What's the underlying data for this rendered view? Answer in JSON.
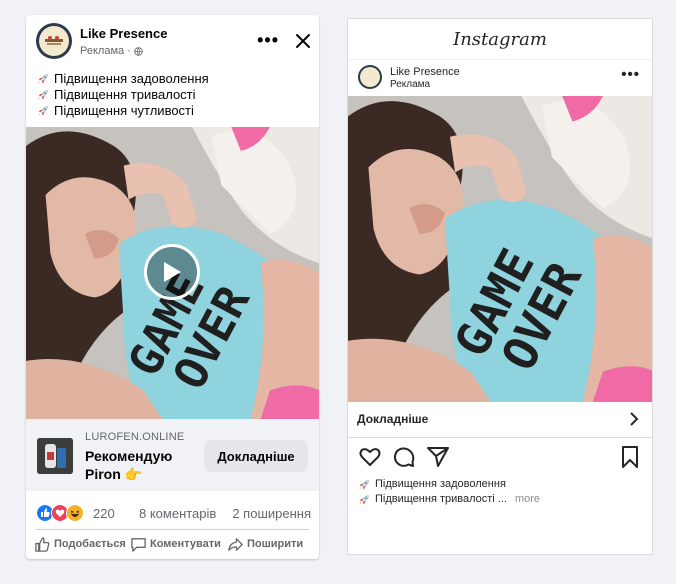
{
  "facebook": {
    "page_name": "Like Presence",
    "sponsored_label": "Реклама",
    "meta_separator": "·",
    "post_lines": [
      "Підвищення задоволення",
      "Підвищення тривалості",
      "Підвищення чутливості"
    ],
    "cta": {
      "domain": "LUROFEN.ONLINE",
      "headline": "Рекомендую Piron 👉",
      "button_label": "Докладніше"
    },
    "stats": {
      "reaction_count": "220",
      "comments": "8 коментарів",
      "shares": "2 поширення"
    },
    "actions": {
      "like": "Подобається",
      "comment": "Коментувати",
      "share": "Поширити"
    },
    "photo_print_text": [
      "GAME",
      "OVER"
    ],
    "reaction_icons": [
      "like-icon",
      "love-icon",
      "haha-icon"
    ]
  },
  "instagram": {
    "logo_text": "Instagram",
    "account_name": "Like Presence",
    "sponsored_label": "Реклама",
    "cta_label": "Докладніше",
    "caption_lines": [
      "Підвищення задоволення",
      "Підвищення тривалості ..."
    ],
    "more_label": "more"
  },
  "colors": {
    "fb_blue": "#1877f2",
    "background": "#f0f2f5",
    "shirt": "#8fd3de"
  }
}
